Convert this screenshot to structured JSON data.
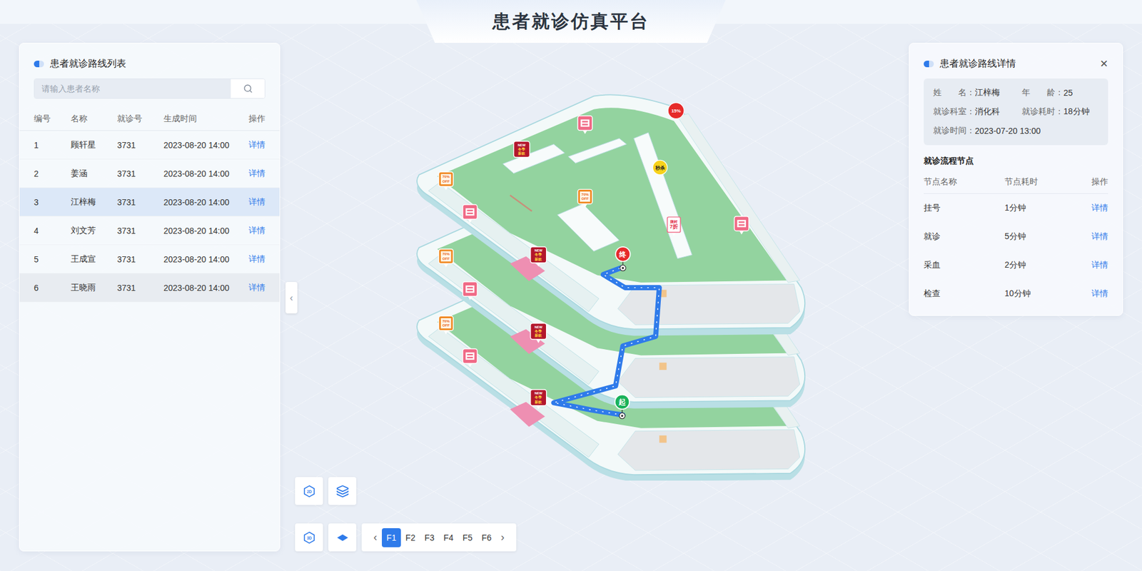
{
  "header": {
    "title": "患者就诊仿真平台"
  },
  "patient_list": {
    "title": "患者就诊路线列表",
    "search": {
      "placeholder": "请输入患者名称"
    },
    "columns": [
      "编号",
      "名称",
      "就诊号",
      "生成时间",
      "操作"
    ],
    "rows": [
      {
        "index": "1",
        "name": "顾轩星",
        "visit_no": "3731",
        "created": "2023-08-20 14:00",
        "action": "详情",
        "selected": false,
        "hovered": false
      },
      {
        "index": "2",
        "name": "姜涵",
        "visit_no": "3731",
        "created": "2023-08-20 14:00",
        "action": "详情",
        "selected": false,
        "hovered": false
      },
      {
        "index": "3",
        "name": "江梓梅",
        "visit_no": "3731",
        "created": "2023-08-20 14:00",
        "action": "详情",
        "selected": true,
        "hovered": false
      },
      {
        "index": "4",
        "name": "刘文芳",
        "visit_no": "3731",
        "created": "2023-08-20 14:00",
        "action": "详情",
        "selected": false,
        "hovered": false
      },
      {
        "index": "5",
        "name": "王成宣",
        "visit_no": "3731",
        "created": "2023-08-20 14:00",
        "action": "详情",
        "selected": false,
        "hovered": false
      },
      {
        "index": "6",
        "name": "王晓雨",
        "visit_no": "3731",
        "created": "2023-08-20 14:00",
        "action": "详情",
        "selected": false,
        "hovered": true
      }
    ]
  },
  "collapse_button": "‹",
  "map": {
    "route": {
      "start": "起",
      "end": "终"
    },
    "pins": [
      {
        "kind": "sale",
        "lines": [
          "70%",
          "OFF"
        ]
      },
      {
        "kind": "sale",
        "lines": [
          "70%",
          "OFF"
        ]
      },
      {
        "kind": "sale",
        "lines": [
          "70%",
          "OFF"
        ]
      },
      {
        "kind": "sale",
        "lines": [
          "70%",
          "OFF"
        ]
      },
      {
        "kind": "new",
        "lines": [
          "NEW",
          "冬季",
          "新款"
        ]
      },
      {
        "kind": "new",
        "lines": [
          "NEW",
          "冬季",
          "新款"
        ]
      },
      {
        "kind": "new",
        "lines": [
          "NEW",
          "冬季",
          "新款"
        ]
      },
      {
        "kind": "new",
        "lines": [
          "NEW",
          "冬季",
          "新款"
        ]
      },
      {
        "kind": "shop",
        "lines": []
      },
      {
        "kind": "shop",
        "lines": []
      },
      {
        "kind": "shop",
        "lines": []
      },
      {
        "kind": "shop",
        "lines": []
      },
      {
        "kind": "shop",
        "lines": []
      },
      {
        "kind": "discount",
        "lines": [
          "15%"
        ]
      },
      {
        "kind": "flash",
        "lines": [
          "秒杀"
        ]
      },
      {
        "kind": "limited",
        "lines": [
          "限时",
          "7折"
        ]
      }
    ]
  },
  "view_controls": {
    "mode_2d": "2D",
    "mode_3d": "3D"
  },
  "floors": {
    "prev": "‹",
    "next": "›",
    "items": [
      {
        "label": "F1",
        "selected": true
      },
      {
        "label": "F2",
        "selected": false
      },
      {
        "label": "F3",
        "selected": false
      },
      {
        "label": "F4",
        "selected": false
      },
      {
        "label": "F5",
        "selected": false
      },
      {
        "label": "F6",
        "selected": false
      }
    ]
  },
  "detail": {
    "title": "患者就诊路线详情",
    "close": "✕",
    "info": [
      {
        "label": "姓　　名：",
        "value": "江梓梅"
      },
      {
        "label": "年　　龄：",
        "value": "25"
      },
      {
        "label": "就诊科室：",
        "value": "消化科"
      },
      {
        "label": "就诊耗时：",
        "value": "18分钟"
      },
      {
        "label": "就诊时间：",
        "value": "2023-07-20 13:00"
      }
    ],
    "nodes_title": "就诊流程节点",
    "columns": [
      "节点名称",
      "节点耗时",
      "操作"
    ],
    "nodes": [
      {
        "name": "挂号",
        "duration": "1分钟",
        "action": "详情"
      },
      {
        "name": "就诊",
        "duration": "5分钟",
        "action": "详情"
      },
      {
        "name": "采血",
        "duration": "2分钟",
        "action": "详情"
      },
      {
        "name": "检查",
        "duration": "10分钟",
        "action": "详情"
      }
    ]
  }
}
